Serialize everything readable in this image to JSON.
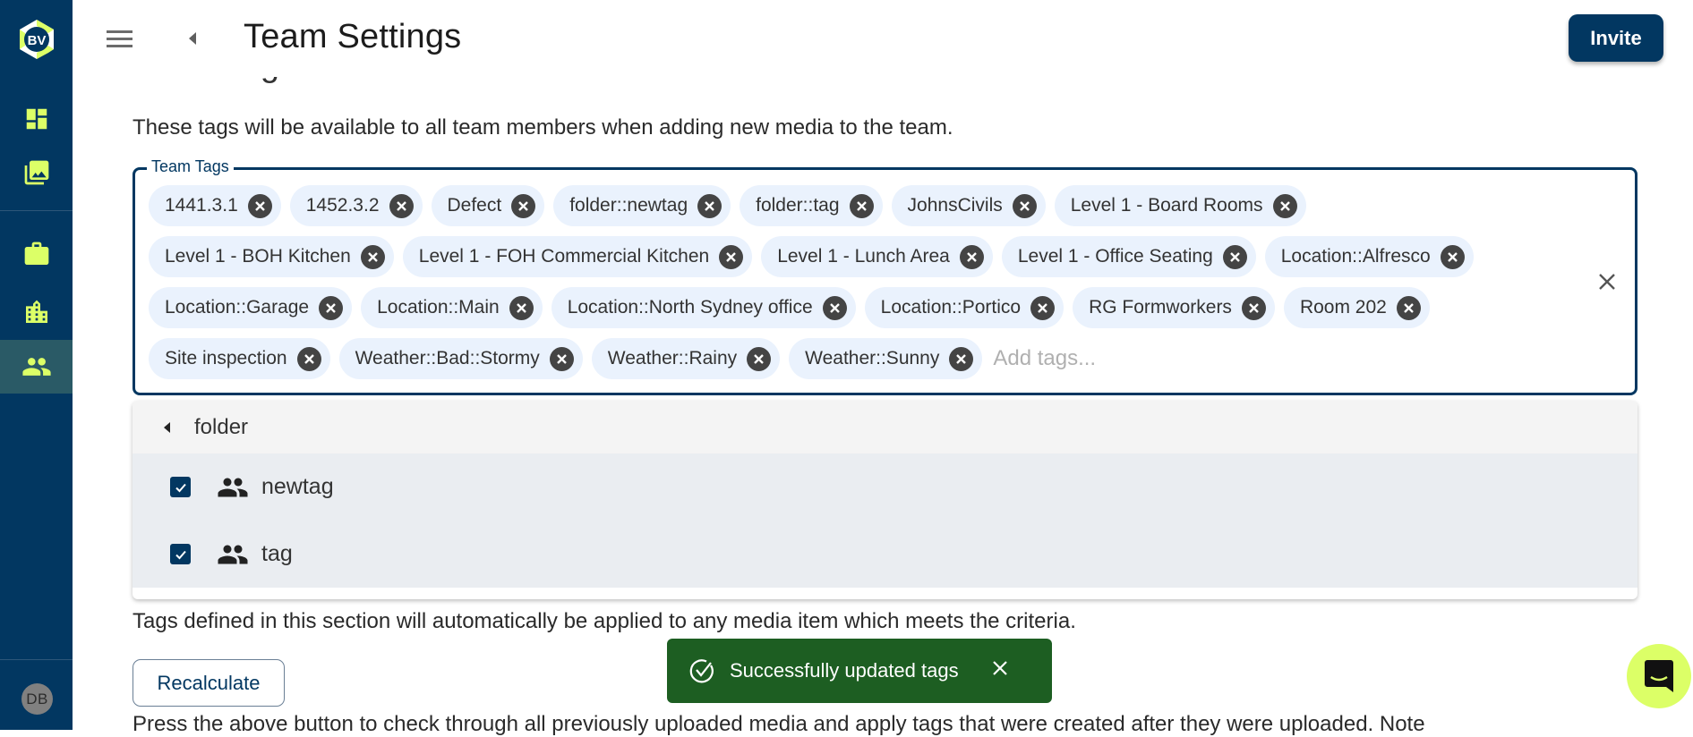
{
  "app": {
    "logo_text": "BV",
    "brand_color": "#023761",
    "accent_color": "#dcff67"
  },
  "sidebar": {
    "items": [
      {
        "name": "dashboard",
        "icon": "dashboard-icon",
        "active": false
      },
      {
        "name": "media",
        "icon": "photo-library-icon",
        "active": false
      },
      {
        "name": "projects",
        "icon": "briefcase-icon",
        "active": false
      },
      {
        "name": "organisation",
        "icon": "building-icon",
        "active": false
      },
      {
        "name": "team",
        "icon": "people-icon",
        "active": true
      }
    ],
    "avatar_initials": "DB"
  },
  "header": {
    "title": "Team Settings",
    "invite_label": "Invite"
  },
  "section": {
    "heading": "Team Tags",
    "description": "These tags will be available to all team members when adding new media to the team."
  },
  "tag_field": {
    "label": "Team Tags",
    "placeholder": "Add tags...",
    "tags": [
      "1441.3.1",
      "1452.3.2",
      "Defect",
      "folder::newtag",
      "folder::tag",
      "JohnsCivils",
      "Level 1 - Board Rooms",
      "Level 1 - BOH Kitchen",
      "Level 1 - FOH Commercial Kitchen",
      "Level 1 - Lunch Area",
      "Level 1 - Office Seating",
      "Location::Alfresco",
      "Location::Garage",
      "Location::Main",
      "Location::North Sydney office",
      "Location::Portico",
      "RG Formworkers",
      "Room 202",
      "Site inspection",
      "Weather::Bad::Stormy",
      "Weather::Rainy",
      "Weather::Sunny"
    ]
  },
  "dropdown": {
    "group": "folder",
    "items": [
      {
        "label": "newtag",
        "checked": true
      },
      {
        "label": "tag",
        "checked": true
      }
    ]
  },
  "auto_tags": {
    "criteria_text": "Tags defined in this section will automatically be applied to any media item which meets the criteria.",
    "recalculate_label": "Recalculate",
    "press_text": "Press the above button to check through all previously uploaded media and apply tags that were created after they were uploaded. Note"
  },
  "toast": {
    "message": "Successfully updated tags",
    "status_color": "#1d5e22"
  }
}
